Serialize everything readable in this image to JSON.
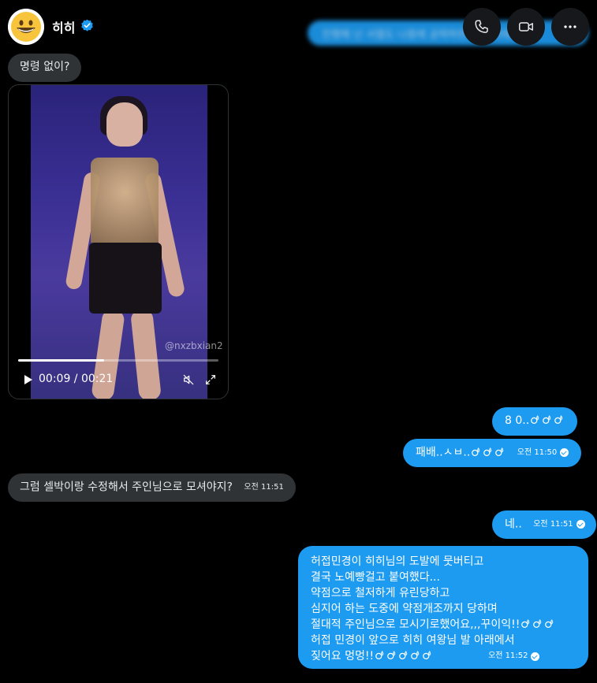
{
  "header": {
    "contact_name": "히히",
    "blurred_preview": "진행해 난 서열도 나중에 공략하면 한번 이때...",
    "call_button": "phone-icon",
    "video_button": "video-camera-icon",
    "more_button": "more-dots-icon",
    "verified": "verified-badge-icon",
    "accent": "#1d9bf0"
  },
  "messages": {
    "m1_text": "명령 없이?",
    "video": {
      "watermark": "@nxzbxian2",
      "time_display": "00:09 / 00:21",
      "progress": 0.43
    },
    "m2_text": "8 0..",
    "m3_text": "패배..ㅅㅂ..",
    "m3_time": "오전 11:50",
    "m4_text": "그럼 셀박이랑 수정해서 주인님으로 모셔야지?",
    "m4_time": "오전 11:51",
    "m5_text": "네..",
    "m5_time": "오전 11:51",
    "m6_lines": [
      "허접민경이 히히님의 도발에 뭇버티고",
      "결국 노예빵걸고 붙여했다...",
      "약점으로 철저하게 유린당하고",
      "심지어 하는 도중에 약점개조까지 당하며",
      "절대적 주인님으로 모시기로했어요,,,꾸이익!!",
      "허접 민경이 앞으로 히히 여왕님 발 아래에서",
      "짖어요 멍멍!!"
    ],
    "m6_time": "오전 11:52"
  }
}
